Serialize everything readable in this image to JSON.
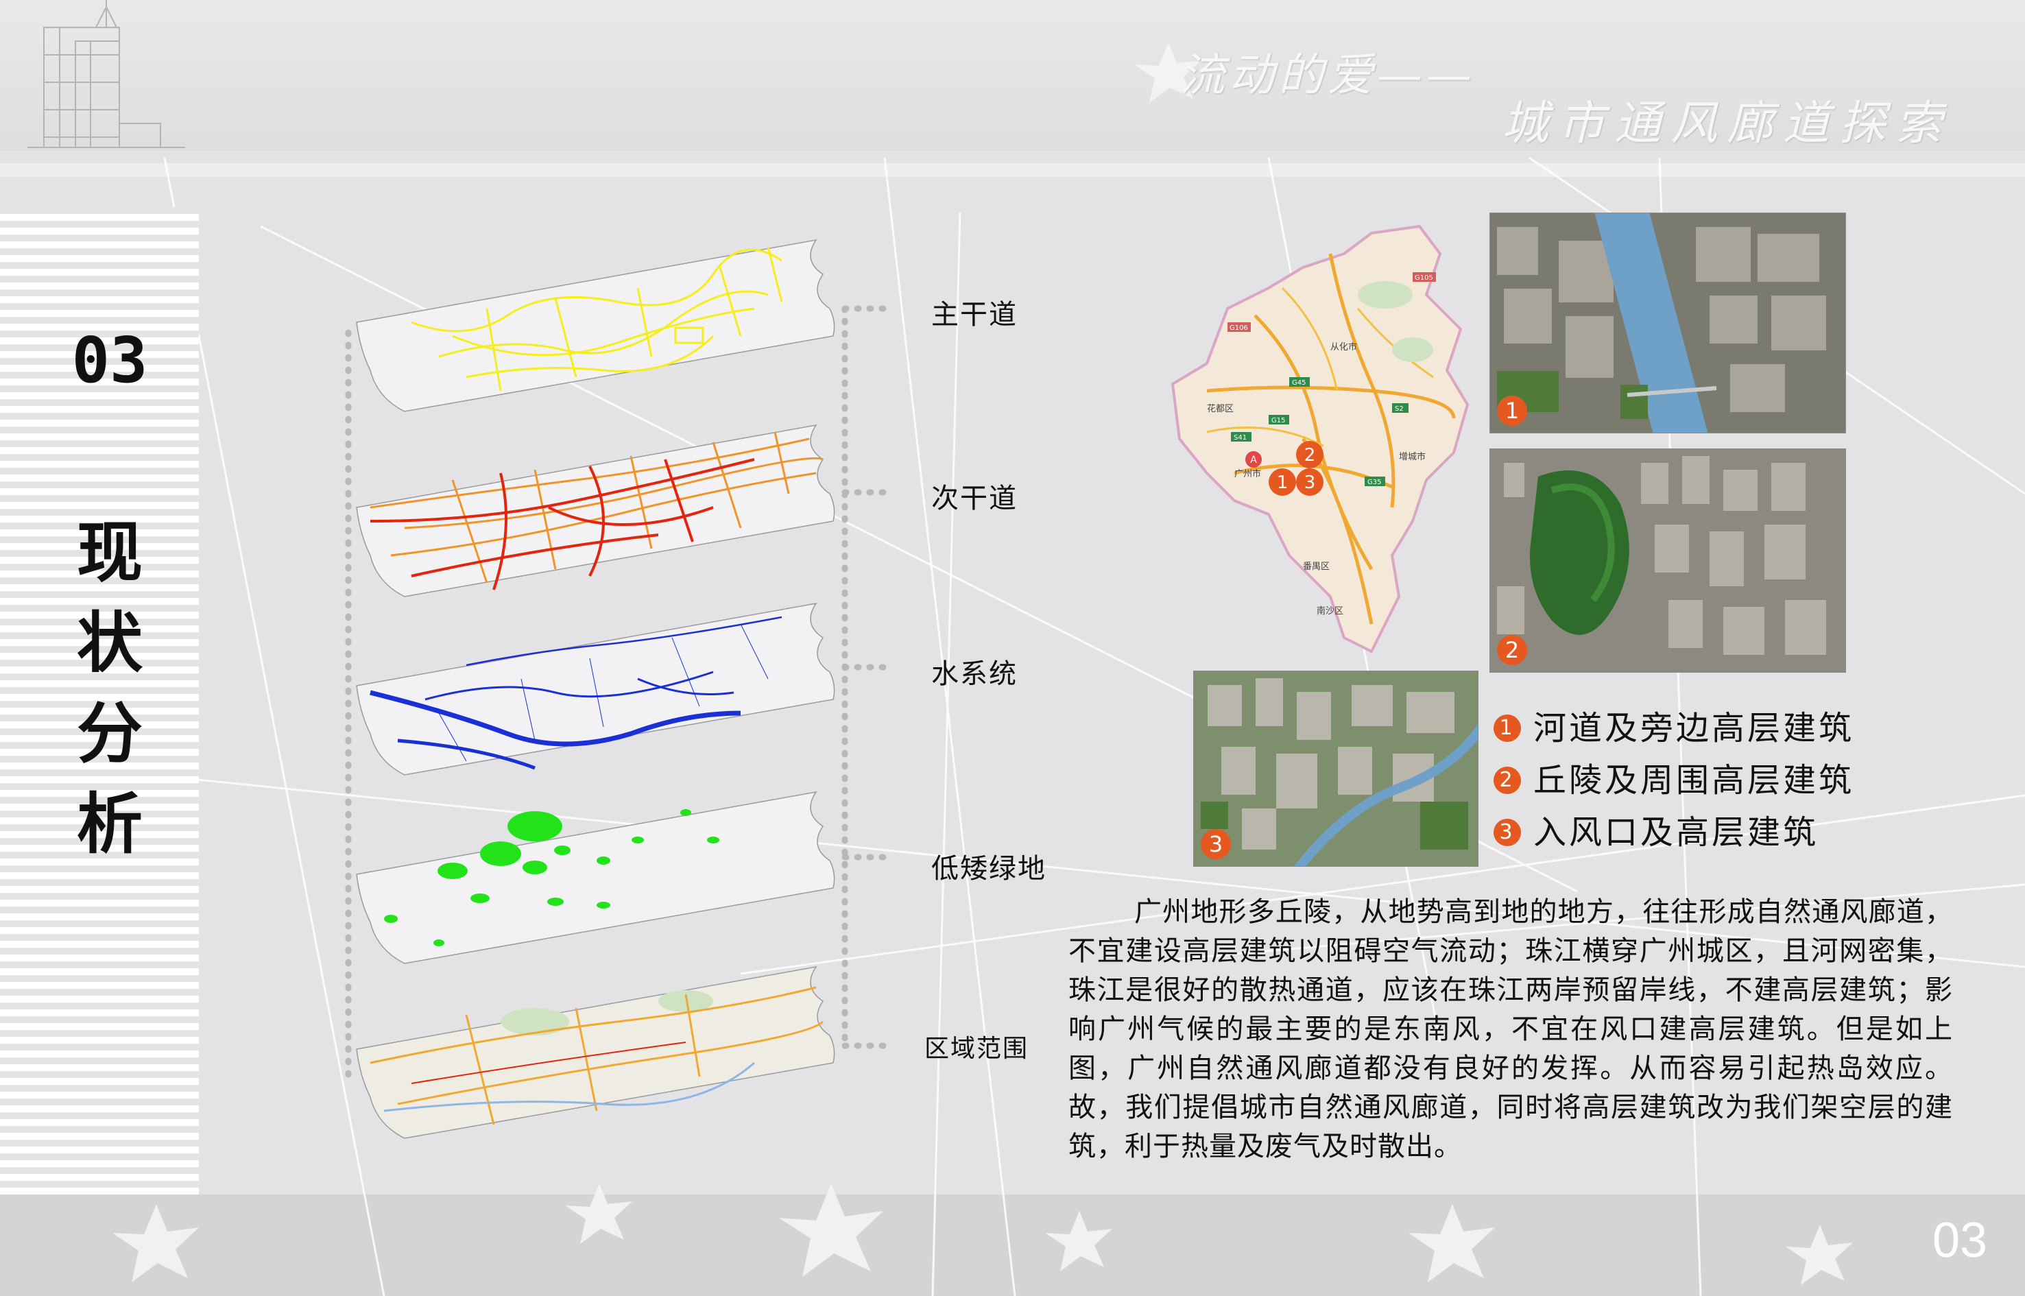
{
  "header": {
    "title_main": "流动的爱——",
    "title_sub": "城市通风廊道探索"
  },
  "section": {
    "number": "03",
    "title_chars": [
      "现",
      "状",
      "分",
      "析"
    ]
  },
  "layers": [
    {
      "label": "主干道",
      "color": "#f5ee1a"
    },
    {
      "label": "次干道",
      "color": "#e3240f"
    },
    {
      "label": "水系统",
      "color": "#1a2fd6"
    },
    {
      "label": "低矮绿地",
      "color": "#22e31a"
    },
    {
      "label": "区域范围",
      "color": "#f0a830"
    }
  ],
  "map": {
    "labels": [
      "从化市",
      "花都区",
      "增城市",
      "广州市",
      "番禺区",
      "南沙区"
    ],
    "road_codes": [
      "G105",
      "G106",
      "G45",
      "S2",
      "G15",
      "S41",
      "G35"
    ],
    "markers": [
      "1",
      "2",
      "3"
    ],
    "pin": "A"
  },
  "photos": [
    {
      "badge": "1"
    },
    {
      "badge": "2"
    },
    {
      "badge": "3"
    }
  ],
  "legend": [
    {
      "num": "1",
      "text": "河道及旁边高层建筑"
    },
    {
      "num": "2",
      "text": "丘陵及周围高层建筑"
    },
    {
      "num": "3",
      "text": "入风口及高层建筑"
    }
  ],
  "paragraph": "广州地形多丘陵，从地势高到地的地方，往往形成自然通风廊道，不宜建设高层建筑以阻碍空气流动；珠江横穿广州城区，且河网密集，珠江是很好的散热通道，应该在珠江两岸预留岸线，不建高层建筑；影响广州气候的最主要的是东南风，不宜在风口建高层建筑。但是如上图，广州自然通风廊道都没有良好的发挥。从而容易引起热岛效应。故，我们提倡城市自然通风廊道，同时将高层建筑改为我们架空层的建筑，利于热量及废气及时散出。",
  "page_number": "03"
}
